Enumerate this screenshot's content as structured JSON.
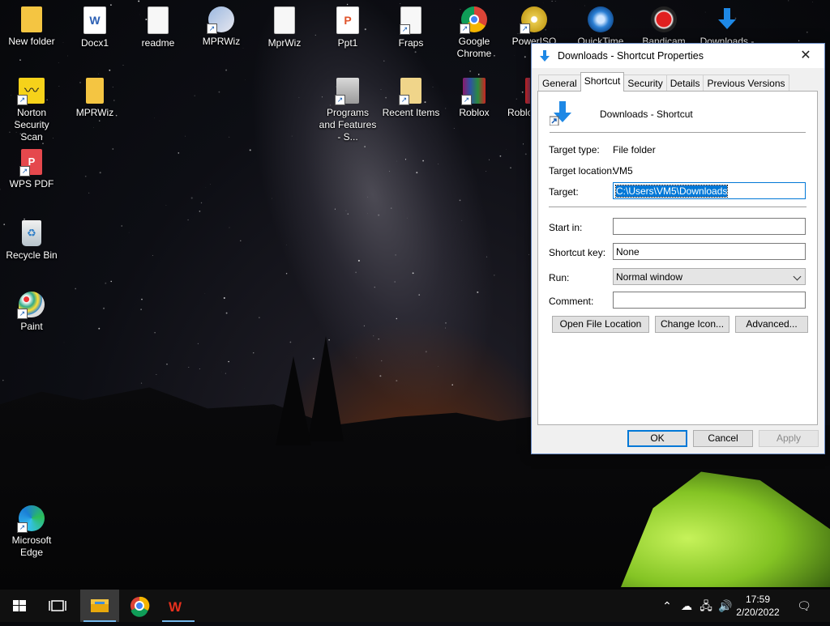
{
  "desktop": {
    "icons": [
      {
        "label": "New folder",
        "icon": "folder-icon"
      },
      {
        "label": "Docx1",
        "icon": "word-document-icon"
      },
      {
        "label": "readme",
        "icon": "text-file-icon"
      },
      {
        "label": "MPRWiz",
        "icon": "mprwiz-setup-icon"
      },
      {
        "label": "MprWiz",
        "icon": "text-file-icon"
      },
      {
        "label": "Ppt1",
        "icon": "presentation-icon"
      },
      {
        "label": "Fraps",
        "icon": "fraps-icon"
      },
      {
        "label": "Google Chrome",
        "icon": "chrome-icon"
      },
      {
        "label": "PowerISO",
        "icon": "poweriso-icon"
      },
      {
        "label": "QuickTime",
        "icon": "quicktime-icon"
      },
      {
        "label": "Bandicam",
        "icon": "bandicam-icon"
      },
      {
        "label": "Downloads -",
        "icon": "downloads-icon"
      },
      {
        "label": "Norton Security Scan",
        "icon": "norton-icon"
      },
      {
        "label": "MPRWiz",
        "icon": "folder-icon"
      },
      {
        "label": "Programs and Features - S...",
        "icon": "programs-features-icon"
      },
      {
        "label": "Recent Items",
        "icon": "recent-items-icon"
      },
      {
        "label": "Roblox",
        "icon": "winrar-icon"
      },
      {
        "label": "Roblo",
        "icon": "roblox-icon"
      },
      {
        "label": "WPS PDF",
        "icon": "wps-pdf-icon"
      },
      {
        "label": "Recycle Bin",
        "icon": "recycle-bin-icon"
      },
      {
        "label": "Paint",
        "icon": "paint-icon"
      },
      {
        "label": "Microsoft Edge",
        "icon": "edge-icon"
      }
    ]
  },
  "dialog": {
    "title": "Downloads - Shortcut Properties",
    "tabs": [
      "General",
      "Shortcut",
      "Security",
      "Details",
      "Previous Versions"
    ],
    "active_tab": "Shortcut",
    "header_name": "Downloads - Shortcut",
    "target_type_label": "Target type:",
    "target_type_value": "File folder",
    "target_location_label": "Target location:",
    "target_location_value": "VM5",
    "target_label": "Target:",
    "target_value": "C:\\Users\\VM5\\Downloads",
    "start_in_label": "Start in:",
    "start_in_value": "",
    "shortcut_key_label": "Shortcut key:",
    "shortcut_key_value": "None",
    "run_label": "Run:",
    "run_value": "Normal window",
    "comment_label": "Comment:",
    "comment_value": "",
    "open_file_location": "Open File Location",
    "change_icon": "Change Icon...",
    "advanced": "Advanced...",
    "ok": "OK",
    "cancel": "Cancel",
    "apply": "Apply"
  },
  "taskbar": {
    "time": "17:59",
    "date": "2/20/2022"
  },
  "colors": {
    "accent": "#0078d7",
    "taskbar": "#101010"
  }
}
